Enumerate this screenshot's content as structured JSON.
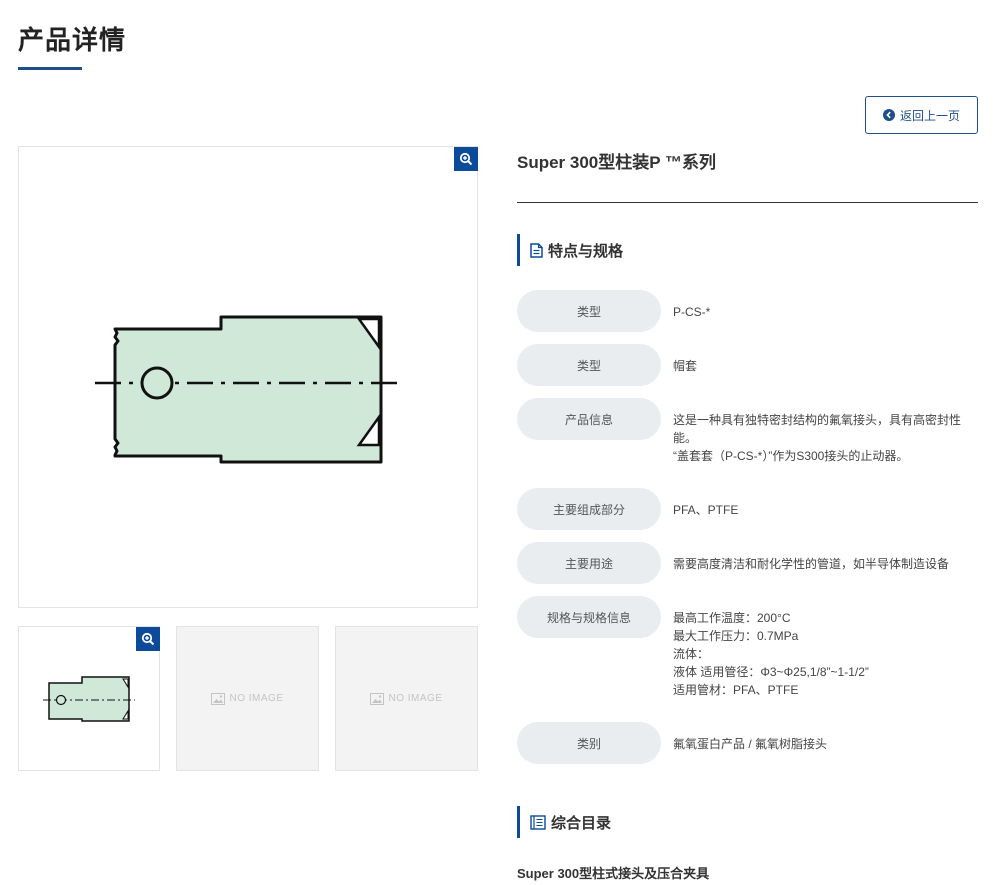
{
  "page": {
    "title": "产品详情",
    "back_label": "返回上一页"
  },
  "colors": {
    "accent": "#0c4a9a",
    "part_fill": "#cfe8d8",
    "label_bg": "#e9edf0"
  },
  "gallery": {
    "main_zoom_icon": "zoom-in-icon",
    "thumb_placeholder": "NO IMAGE"
  },
  "product": {
    "title": "Super 300型柱装P ™系列"
  },
  "spec_section": {
    "title": "特点与规格",
    "icon": "document-icon"
  },
  "specs": [
    {
      "label": "类型",
      "lines": [
        "P-CS-*"
      ]
    },
    {
      "label": "类型",
      "lines": [
        "帽套"
      ]
    },
    {
      "label": "产品信息",
      "lines": [
        "这是一种具有独特密封结构的氟氧接头，具有高密封性能。",
        "“盖套套（P-CS-*）”作为S300接头的止动器。"
      ]
    },
    {
      "label": "主要组成部分",
      "lines": [
        "PFA、PTFE"
      ]
    },
    {
      "label": "主要用途",
      "lines": [
        "需要高度清洁和耐化学性的管道，如半导体制造设备"
      ]
    },
    {
      "label": "规格与规格信息",
      "lines": [
        "最高工作温度：200°C",
        "最大工作压力：0.7MPa",
        "流体：",
        "液体 适用管径：Φ3~Φ25,1/8”~1-1/2”",
        "适用管材：PFA、PTFE"
      ]
    },
    {
      "label": "类别",
      "lines": [
        "氟氧蛋白产品 / 氟氧树脂接头"
      ]
    }
  ],
  "catalog_section": {
    "title": "综合目录",
    "icon": "catalog-book-icon",
    "item": "Super 300型柱式接头及压合夹具"
  }
}
